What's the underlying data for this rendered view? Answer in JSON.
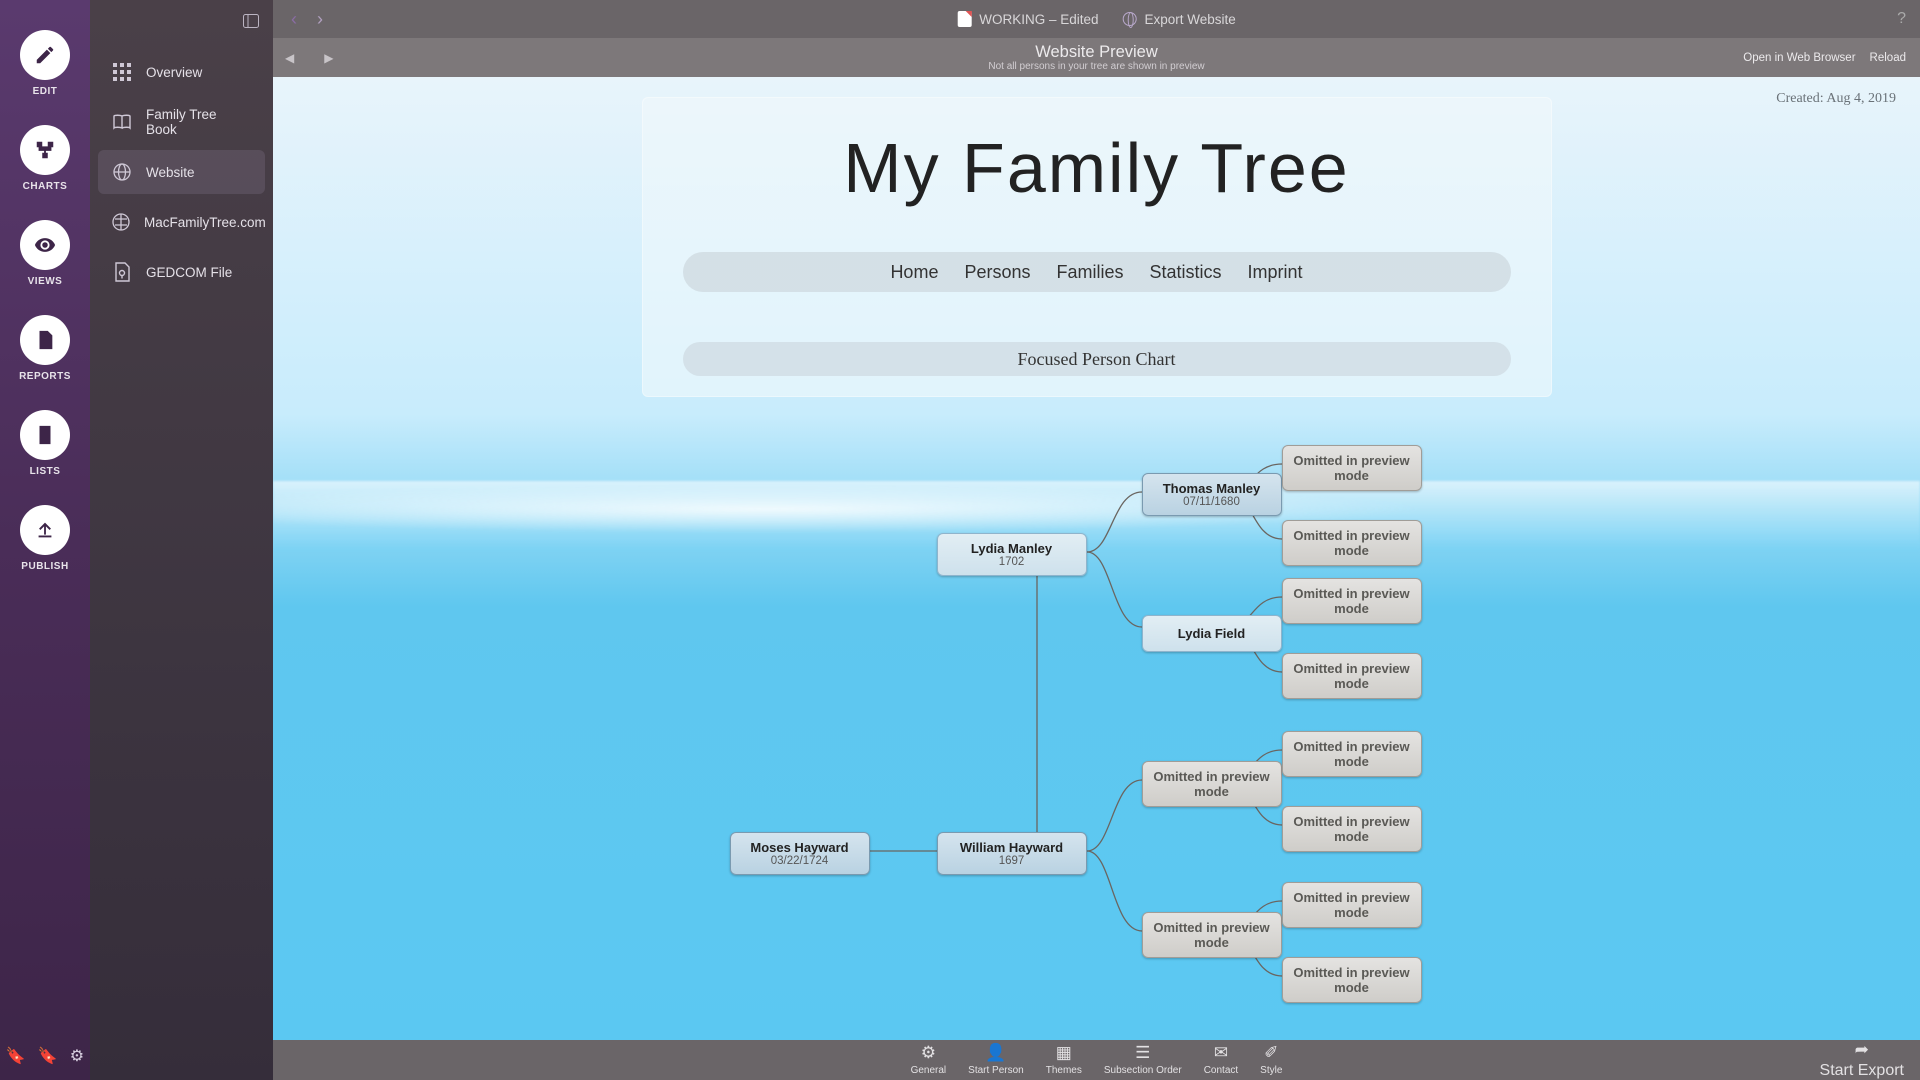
{
  "rail": {
    "items": [
      "EDIT",
      "CHARTS",
      "VIEWS",
      "REPORTS",
      "LISTS",
      "PUBLISH"
    ],
    "active": 5
  },
  "sidebar": {
    "items": [
      "Overview",
      "Family Tree Book",
      "Website",
      "MacFamilyTree.com",
      "GEDCOM File"
    ],
    "active": 2
  },
  "top": {
    "doc": "WORKING – Edited",
    "export": "Export Website"
  },
  "sub": {
    "title": "Website Preview",
    "note": "Not all persons in your tree are shown in preview",
    "open": "Open in Web Browser",
    "reload": "Reload"
  },
  "bottom": {
    "items": [
      "General",
      "Start Person",
      "Themes",
      "Subsection Order",
      "Contact",
      "Style"
    ],
    "export": "Start Export"
  },
  "site": {
    "title": "My Family Tree",
    "nav": [
      "Home",
      "Persons",
      "Families",
      "Statistics",
      "Imprint"
    ],
    "section": "Focused Person Chart",
    "created": "Created: Aug 4, 2019"
  },
  "tree": {
    "moses": {
      "name": "Moses Hayward",
      "date": "03/22/1724"
    },
    "lydia_m": {
      "name": "Lydia Manley",
      "date": "1702"
    },
    "william": {
      "name": "William Hayward",
      "date": "1697"
    },
    "thomas": {
      "name": "Thomas Manley",
      "date": "07/11/1680"
    },
    "lydia_f": {
      "name": "Lydia Field"
    },
    "omitted_gp1": {
      "name": "Omitted in preview mode"
    },
    "omitted_gp2": {
      "name": "Omitted in preview mode"
    },
    "omitted": "Omitted in preview mode"
  }
}
